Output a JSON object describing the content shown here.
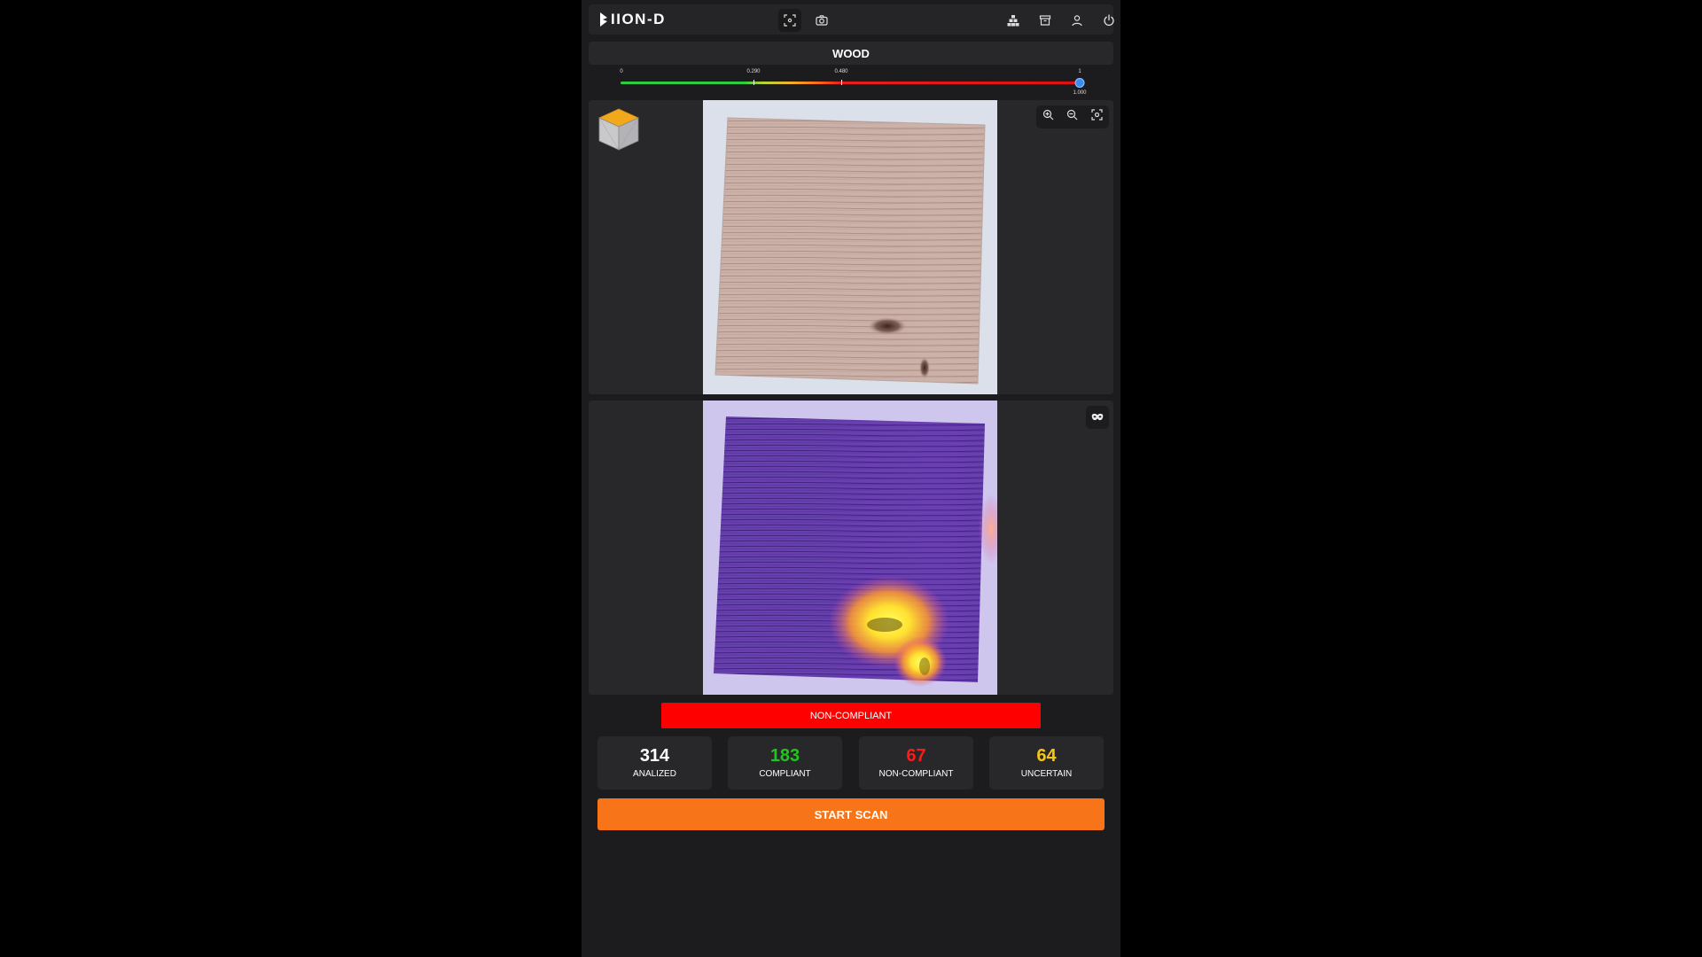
{
  "header": {
    "logo_text": "IION-D",
    "nav_icons": [
      "scan-target-icon",
      "camera-icon",
      "dataset-icon",
      "archive-icon",
      "user-icon",
      "power-icon"
    ],
    "active_icon": "scan-target-icon"
  },
  "material": {
    "title": "WOOD"
  },
  "threshold_slider": {
    "min_label": "0",
    "mark1_label": "0.290",
    "mark2_label": "0.480",
    "max_label": "1",
    "value_label": "1.000",
    "value": 1.0,
    "mark1": 0.29,
    "mark2": 0.48
  },
  "viewer": {
    "zoom_controls": [
      "zoom-in-icon",
      "zoom-out-icon",
      "fit-screen-icon"
    ],
    "overlay_toggle_icon": "mask-icon"
  },
  "result": {
    "status": "NON-COMPLIANT",
    "status_color": "#ff0000"
  },
  "stats": [
    {
      "value": "314",
      "label": "ANALIZED",
      "color": "#ffffff"
    },
    {
      "value": "183",
      "label": "COMPLIANT",
      "color": "#22c51e"
    },
    {
      "value": "67",
      "label": "NON-COMPLIANT",
      "color": "#ff1a1a"
    },
    {
      "value": "64",
      "label": "UNCERTAIN",
      "color": "#f5c518"
    }
  ],
  "actions": {
    "start_scan_label": "START SCAN",
    "accent": "#f77418"
  }
}
